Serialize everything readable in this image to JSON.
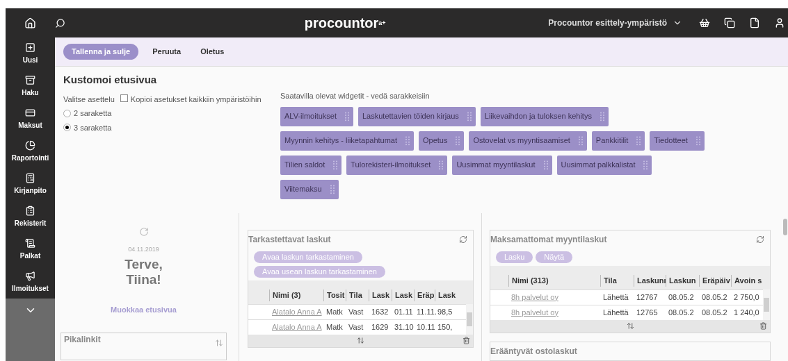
{
  "topbar": {
    "logo": "procountor",
    "logo_mark": "a+",
    "environment": "Procountor esittely-ympäristö"
  },
  "sidebar": {
    "items": [
      {
        "label": "Uusi"
      },
      {
        "label": "Haku"
      },
      {
        "label": "Maksut"
      },
      {
        "label": "Raportointi"
      },
      {
        "label": "Kirjanpito"
      },
      {
        "label": "Rekisterit"
      },
      {
        "label": "Palkat"
      },
      {
        "label": "Ilmoitukset"
      }
    ]
  },
  "toolbar": {
    "buttons": [
      {
        "label": "Tallenna ja sulje",
        "primary": true
      },
      {
        "label": "Peruuta",
        "primary": false
      },
      {
        "label": "Oletus",
        "primary": false
      }
    ]
  },
  "customize": {
    "title": "Kustomoi etusivua",
    "layout_label": "Valitse asettelu",
    "copy_checkbox": {
      "label": "Kopioi asetukset kaikkiin ympäristöihin",
      "checked": false
    },
    "layouts": [
      {
        "label": "2 saraketta",
        "selected": false
      },
      {
        "label": "3 saraketta",
        "selected": true
      }
    ],
    "widgets_label": "Saatavilla olevat widgetit - vedä sarakkeisiin",
    "widget_rows": [
      [
        "ALV-ilmoitukset",
        "Laskutettavien töiden kirjaus",
        "Liikevaihdon ja tuloksen kehitys"
      ],
      [
        "Myynnin kehitys - liiketapahtumat",
        "Opetus",
        "Ostovelat vs myyntisaamiset",
        "Pankkitilit",
        "Tiedotteet"
      ],
      [
        "Tilien saldot",
        "Tulorekisteri-ilmoitukset",
        "Uusimmat myyntilaskut",
        "Uusimmat palkkalistat"
      ],
      [
        "Viitemaksu"
      ]
    ]
  },
  "greeting": {
    "date": "04.11.2019",
    "lines": [
      "Terve,",
      "Tiina!"
    ],
    "edit_link": "Muokkaa etusivua"
  },
  "quicklinks": {
    "title": "Pikalinkit"
  },
  "invoices_to_review": {
    "title": "Tarkastettavat laskut",
    "buttons": [
      "Avaa laskun tarkastaminen",
      "Avaa usean laskun tarkastaminen"
    ],
    "columns": [
      "Nimi (3)",
      "Tosit",
      "Tila",
      "Lask",
      "Lask",
      "Eräp",
      "Lask"
    ],
    "rows": [
      [
        "Alatalo Anna A",
        "Matk",
        "Vast",
        "1632",
        "01.11",
        "11.11.",
        "98,5"
      ],
      [
        "Alatalo Anna A",
        "Matk",
        "Vast",
        "1629",
        "31.10",
        "10.11",
        "150,"
      ]
    ]
  },
  "unpaid_sales": {
    "title": "Maksamattomat myyntilaskut",
    "buttons": [
      "Lasku",
      "Näytä"
    ],
    "columns": [
      "Nimi (313)",
      "Tila",
      "Laskunı",
      "Laskun",
      "Eräpäiv",
      "Avoin s"
    ],
    "rows": [
      [
        "8h palvelut oy",
        "Lähettä",
        "12767",
        "08.05.2",
        "08.05.2",
        "2 750,0"
      ],
      [
        "8h palvelut oy",
        "Lähettä",
        "12765",
        "08.05.2",
        "08.05.2",
        "1 240,0"
      ]
    ]
  },
  "overdue_purchases": {
    "title": "Erääntyvät ostolaskut"
  }
}
